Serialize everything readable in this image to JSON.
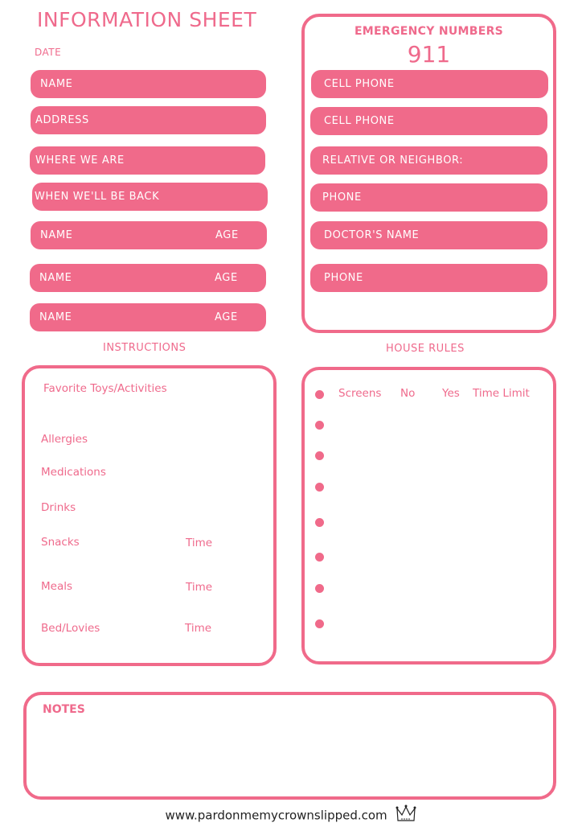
{
  "header": {
    "title": "INFORMATION SHEET",
    "date_label": "DATE"
  },
  "left_fields": [
    {
      "label": "NAME"
    },
    {
      "label": "ADDRESS"
    },
    {
      "label": "WHERE WE ARE"
    },
    {
      "label": "WHEN WE'LL BE BACK"
    }
  ],
  "children": [
    {
      "name_label": "NAME",
      "age_label": "AGE"
    },
    {
      "name_label": "NAME",
      "age_label": "AGE"
    },
    {
      "name_label": "NAME",
      "age_label": "AGE"
    }
  ],
  "emergency": {
    "title": "EMERGENCY NUMBERS",
    "number": "911",
    "fields": [
      {
        "label": "CELL PHONE"
      },
      {
        "label": "CELL PHONE"
      },
      {
        "label": "RELATIVE OR NEIGHBOR:"
      },
      {
        "label": "PHONE"
      },
      {
        "label": "DOCTOR'S NAME"
      },
      {
        "label": "PHONE"
      }
    ]
  },
  "instructions": {
    "heading": "INSTRUCTIONS",
    "items": [
      {
        "label": "Favorite Toys/Activities"
      },
      {
        "label": "Allergies"
      },
      {
        "label": "Medications"
      },
      {
        "label": "Drinks"
      },
      {
        "label": "Snacks",
        "time_label": "Time"
      },
      {
        "label": "Meals",
        "time_label": "Time"
      },
      {
        "label": "Bed/Lovies",
        "time_label": "Time"
      }
    ]
  },
  "house_rules": {
    "heading": "HOUSE RULES",
    "first_rule": {
      "label": "Screens",
      "no": "No",
      "yes": "Yes",
      "limit": "Time Limit"
    },
    "bullet_count": 8
  },
  "notes": {
    "label": "NOTES"
  },
  "footer": {
    "url": "www.pardonmemycrownslipped.com",
    "logo_icon": "crown-icon"
  },
  "colors": {
    "accent": "#f06a8a",
    "text_on_accent": "#ffffff"
  }
}
